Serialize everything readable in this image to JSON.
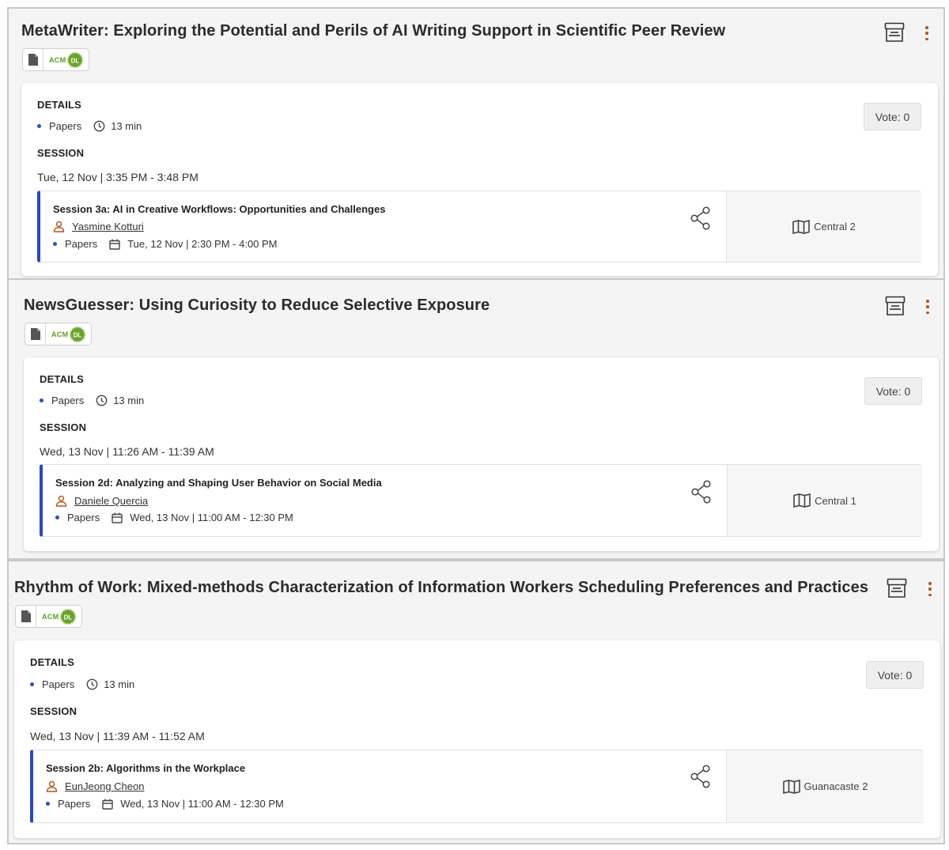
{
  "colors": {
    "accent_blue": "#2747c9",
    "icon_orange": "#b5541f",
    "acm_green": "#5d9a23"
  },
  "labels": {
    "details": "DETAILS",
    "session": "SESSION",
    "acm": "ACM",
    "dl": "DL"
  },
  "papers": [
    {
      "title": "MetaWriter: Exploring the Potential and Perils of AI Writing Support in Scientific Peer Review",
      "type": "Papers",
      "duration": "13 min",
      "vote": "Vote: 0",
      "time": "Tue, 12 Nov | 3:35 PM - 3:48 PM",
      "session_name": "Session 3a: AI in Creative Workflows: Opportunities and Challenges",
      "author": "Yasmine Kotturi",
      "session_type": "Papers",
      "session_time": "Tue, 12 Nov | 2:30 PM - 4:00 PM",
      "room": "Central 2"
    },
    {
      "title": "NewsGuesser: Using Curiosity to Reduce Selective Exposure",
      "type": "Papers",
      "duration": "13 min",
      "vote": "Vote: 0",
      "time": "Wed, 13 Nov | 11:26 AM - 11:39 AM",
      "session_name": "Session 2d: Analyzing and Shaping User Behavior on Social Media",
      "author": "Daniele Quercia",
      "session_type": "Papers",
      "session_time": "Wed, 13 Nov | 11:00 AM - 12:30 PM",
      "room": "Central 1"
    },
    {
      "title": "Rhythm of Work: Mixed-methods Characterization of Information Workers Scheduling Preferences and Practices",
      "type": "Papers",
      "duration": "13 min",
      "vote": "Vote: 0",
      "time": "Wed, 13 Nov | 11:39 AM - 11:52 AM",
      "session_name": "Session 2b: Algorithms in the Workplace",
      "author": "EunJeong Cheon",
      "session_type": "Papers",
      "session_time": "Wed, 13 Nov | 11:00 AM - 12:30 PM",
      "room": "Guanacaste 2"
    }
  ]
}
